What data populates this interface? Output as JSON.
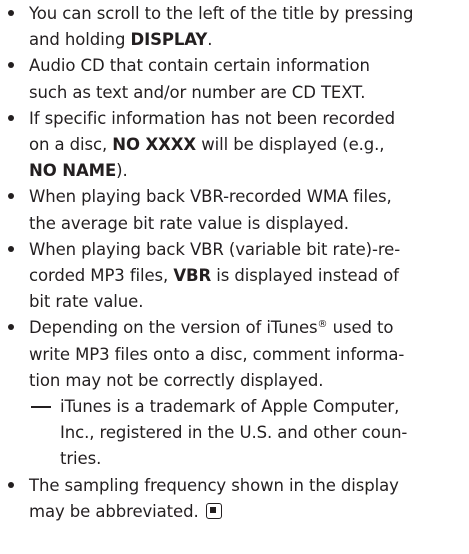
{
  "notes": {
    "item1": {
      "line1": "You can scroll to the left of the title by pressing",
      "line2_pre": "and holding ",
      "line2_bold": "DISPLAY",
      "line2_post": "."
    },
    "item2": {
      "line1": "Audio CD that contain certain information",
      "line2": "such as text and/or number are CD TEXT."
    },
    "item3": {
      "line1": "If specific information has not been recorded",
      "line2_pre": "on a disc, ",
      "line2_bold": "NO XXXX",
      "line2_post": " will be displayed (e.g.,",
      "line3_bold": "NO NAME",
      "line3_post": ")."
    },
    "item4": {
      "line1": "When playing back VBR-recorded WMA files,",
      "line2": "the average bit rate value is displayed."
    },
    "item5": {
      "line1": "When playing back VBR (variable bit rate)-re-",
      "line2_pre": "corded MP3 files, ",
      "line2_bold": "VBR",
      "line2_post": " is displayed instead of",
      "line3": "bit rate value."
    },
    "item6": {
      "line1_pre": "Depending on the version of iTunes",
      "line1_reg": "®",
      "line1_post": " used to",
      "line2": "write MP3 files onto a disc, comment informa-",
      "line3": "tion may not be correctly displayed.",
      "sub": {
        "line1": "iTunes is a trademark of Apple Computer,",
        "line2": "Inc., registered in the U.S. and other coun-",
        "line3": "tries."
      }
    },
    "item7": {
      "line1": "The sampling frequency shown in the display",
      "line2": "may be abbreviated.",
      "end_icon": "stop-square-icon"
    }
  }
}
